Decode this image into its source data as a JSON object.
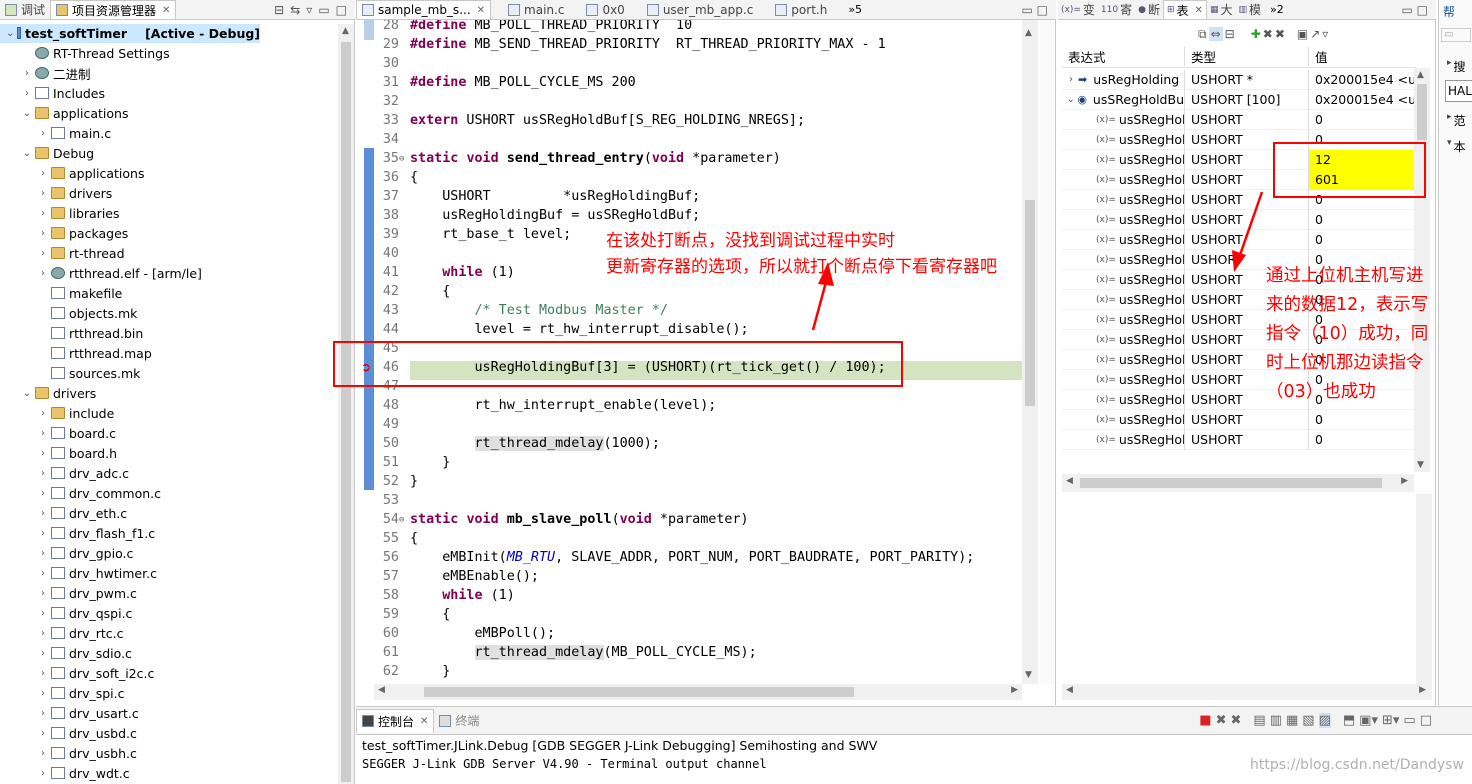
{
  "left_panel": {
    "tabs": [
      {
        "label": "调试",
        "icon": "bug-icon"
      },
      {
        "label": "项目资源管理器",
        "icon": "folder-icon"
      }
    ]
  },
  "tree": [
    {
      "label": "test_softTimer",
      "suffix": "[Active - Debug]",
      "depth": 0,
      "expanded": true,
      "icon": "project-icon"
    },
    {
      "label": "RT-Thread Settings",
      "depth": 1,
      "icon": "settings-icon"
    },
    {
      "label": "二进制",
      "depth": 1,
      "collapsed": true,
      "icon": "binary-icon"
    },
    {
      "label": "Includes",
      "depth": 1,
      "collapsed": true,
      "icon": "includes-icon"
    },
    {
      "label": "applications",
      "depth": 1,
      "expanded": true,
      "icon": "folder-icon"
    },
    {
      "label": "main.c",
      "depth": 2,
      "collapsed": true,
      "icon": "c-file-icon"
    },
    {
      "label": "Debug",
      "depth": 1,
      "expanded": true,
      "icon": "folder-icon"
    },
    {
      "label": "applications",
      "depth": 2,
      "collapsed": true,
      "icon": "folder-icon"
    },
    {
      "label": "drivers",
      "depth": 2,
      "collapsed": true,
      "icon": "folder-icon"
    },
    {
      "label": "libraries",
      "depth": 2,
      "collapsed": true,
      "icon": "folder-icon"
    },
    {
      "label": "packages",
      "depth": 2,
      "collapsed": true,
      "icon": "folder-icon"
    },
    {
      "label": "rt-thread",
      "depth": 2,
      "collapsed": true,
      "icon": "folder-icon"
    },
    {
      "label": "rtthread.elf - [arm/le]",
      "depth": 2,
      "collapsed": true,
      "icon": "elf-icon"
    },
    {
      "label": "makefile",
      "depth": 2,
      "icon": "file-icon"
    },
    {
      "label": "objects.mk",
      "depth": 2,
      "icon": "file-icon"
    },
    {
      "label": "rtthread.bin",
      "depth": 2,
      "icon": "file-icon"
    },
    {
      "label": "rtthread.map",
      "depth": 2,
      "icon": "file-icon"
    },
    {
      "label": "sources.mk",
      "depth": 2,
      "icon": "file-icon"
    },
    {
      "label": "drivers",
      "depth": 1,
      "expanded": true,
      "icon": "folder-icon"
    },
    {
      "label": "include",
      "depth": 2,
      "collapsed": true,
      "icon": "folder-icon"
    },
    {
      "label": "board.c",
      "depth": 2,
      "collapsed": true,
      "icon": "c-file-icon"
    },
    {
      "label": "board.h",
      "depth": 2,
      "collapsed": true,
      "icon": "h-file-icon"
    },
    {
      "label": "drv_adc.c",
      "depth": 2,
      "collapsed": true,
      "icon": "c-file-icon"
    },
    {
      "label": "drv_common.c",
      "depth": 2,
      "collapsed": true,
      "icon": "c-file-icon"
    },
    {
      "label": "drv_eth.c",
      "depth": 2,
      "collapsed": true,
      "icon": "c-file-icon"
    },
    {
      "label": "drv_flash_f1.c",
      "depth": 2,
      "collapsed": true,
      "icon": "c-file-icon"
    },
    {
      "label": "drv_gpio.c",
      "depth": 2,
      "collapsed": true,
      "icon": "c-file-icon"
    },
    {
      "label": "drv_hwtimer.c",
      "depth": 2,
      "collapsed": true,
      "icon": "c-file-icon"
    },
    {
      "label": "drv_pwm.c",
      "depth": 2,
      "collapsed": true,
      "icon": "c-file-icon"
    },
    {
      "label": "drv_qspi.c",
      "depth": 2,
      "collapsed": true,
      "icon": "c-file-icon"
    },
    {
      "label": "drv_rtc.c",
      "depth": 2,
      "collapsed": true,
      "icon": "c-file-icon"
    },
    {
      "label": "drv_sdio.c",
      "depth": 2,
      "collapsed": true,
      "icon": "c-file-icon"
    },
    {
      "label": "drv_soft_i2c.c",
      "depth": 2,
      "collapsed": true,
      "icon": "c-file-icon"
    },
    {
      "label": "drv_spi.c",
      "depth": 2,
      "collapsed": true,
      "icon": "c-file-icon"
    },
    {
      "label": "drv_usart.c",
      "depth": 2,
      "collapsed": true,
      "icon": "c-file-icon"
    },
    {
      "label": "drv_usbd.c",
      "depth": 2,
      "collapsed": true,
      "icon": "c-file-icon"
    },
    {
      "label": "drv_usbh.c",
      "depth": 2,
      "collapsed": true,
      "icon": "c-file-icon"
    },
    {
      "label": "drv_wdt.c",
      "depth": 2,
      "collapsed": true,
      "icon": "c-file-icon"
    }
  ],
  "editor": {
    "tabs": [
      {
        "label": "sample_mb_s...",
        "active": true
      },
      {
        "label": "main.c"
      },
      {
        "label": "0x0"
      },
      {
        "label": "user_mb_app.c"
      },
      {
        "label": "port.h"
      }
    ],
    "overflow": "»5",
    "lines": [
      {
        "n": "28",
        "html": "<span class='kw'>#define</span> MB_POLL_THREAD_PRIORITY  10"
      },
      {
        "n": "29",
        "html": "<span class='kw'>#define</span> MB_SEND_THREAD_PRIORITY  RT_THREAD_PRIORITY_MAX - 1"
      },
      {
        "n": "30",
        "html": ""
      },
      {
        "n": "31",
        "html": "<span class='kw'>#define</span> MB_POLL_CYCLE_MS 200"
      },
      {
        "n": "32",
        "html": ""
      },
      {
        "n": "33",
        "html": "<span class='kw'>extern</span> USHORT usSRegHoldBuf[S_REG_HOLDING_NREGS];"
      },
      {
        "n": "34",
        "html": ""
      },
      {
        "n": "35",
        "html": "<span class='kw'>static</span> <span class='kw'>void</span> <b>send_thread_entry</b>(<span class='kw'>void</span> *parameter)"
      },
      {
        "n": "36",
        "html": "{"
      },
      {
        "n": "37",
        "html": "    USHORT         *usRegHoldingBuf;"
      },
      {
        "n": "38",
        "html": "    usRegHoldingBuf = usSRegHoldBuf;"
      },
      {
        "n": "39",
        "html": "    rt_base_t level;"
      },
      {
        "n": "40",
        "html": ""
      },
      {
        "n": "41",
        "html": "    <span class='kw'>while</span> (1)"
      },
      {
        "n": "42",
        "html": "    {"
      },
      {
        "n": "43",
        "html": "        <span class='cm'>/* Test Modbus Master */</span>"
      },
      {
        "n": "44",
        "html": "        level = rt_hw_interrupt_disable();"
      },
      {
        "n": "45",
        "html": ""
      },
      {
        "n": "46",
        "html": "        usRegHoldingBuf[3] = (USHORT)(rt_tick_get() / 100);"
      },
      {
        "n": "47",
        "html": ""
      },
      {
        "n": "48",
        "html": "        rt_hw_interrupt_enable(level);"
      },
      {
        "n": "49",
        "html": ""
      },
      {
        "n": "50",
        "html": "        <span class='hl'>rt_thread_mdelay</span>(1000);"
      },
      {
        "n": "51",
        "html": "    }"
      },
      {
        "n": "52",
        "html": "}"
      },
      {
        "n": "53",
        "html": ""
      },
      {
        "n": "54",
        "html": "<span class='kw'>static</span> <span class='kw'>void</span> <b>mb_slave_poll</b>(<span class='kw'>void</span> *parameter)"
      },
      {
        "n": "55",
        "html": "{"
      },
      {
        "n": "56",
        "html": "    eMBInit(<span class='it'>MB_RTU</span>, SLAVE_ADDR, PORT_NUM, PORT_BAUDRATE, PORT_PARITY);"
      },
      {
        "n": "57",
        "html": "    eMBEnable();"
      },
      {
        "n": "58",
        "html": "    <span class='kw'>while</span> (1)"
      },
      {
        "n": "59",
        "html": "    {"
      },
      {
        "n": "60",
        "html": "        eMBPoll();"
      },
      {
        "n": "61",
        "html": "        <span class='hl'>rt_thread_mdelay</span>(MB_POLL_CYCLE_MS);"
      },
      {
        "n": "62",
        "html": "    }"
      }
    ]
  },
  "annotation_left": {
    "line1": "在该处打断点，没找到调试过程中实时",
    "line2": "更新寄存器的选项，所以就打个断点停下看寄存器吧"
  },
  "annotation_right": {
    "line1": "通过上位机主机写进",
    "line2": "来的数据12，表示写",
    "line3": "指令（10）成功，同",
    "line4": "时上位机那边读指令",
    "line5": "（03）也成功"
  },
  "vars": {
    "tabs": [
      {
        "label": "变"
      },
      {
        "label": "寄"
      },
      {
        "label": "断"
      },
      {
        "label": "表",
        "active": true
      },
      {
        "label": "大"
      },
      {
        "label": "模"
      }
    ],
    "overflow": "»2",
    "headers": {
      "expr": "表达式",
      "type": "类型",
      "value": "值"
    },
    "rows": [
      {
        "expr": "usRegHolding",
        "type": "USHORT *",
        "value": "0x200015e4 <usS",
        "kind": "pointer"
      },
      {
        "expr": "usSRegHoldBu",
        "type": "USHORT [100]",
        "value": "0x200015e4 <usS",
        "kind": "array"
      },
      {
        "expr": "usSRegHolc",
        "type": "USHORT",
        "value": "0"
      },
      {
        "expr": "usSRegHolc",
        "type": "USHORT",
        "value": "0"
      },
      {
        "expr": "usSRegHolc",
        "type": "USHORT",
        "value": "12",
        "highlight": true
      },
      {
        "expr": "usSRegHolc",
        "type": "USHORT",
        "value": "601",
        "highlight": true
      },
      {
        "expr": "usSRegHolc",
        "type": "USHORT",
        "value": "0"
      },
      {
        "expr": "usSRegHolc",
        "type": "USHORT",
        "value": "0"
      },
      {
        "expr": "usSRegHolc",
        "type": "USHORT",
        "value": "0"
      },
      {
        "expr": "usSRegHolc",
        "type": "USHORT",
        "value": "0"
      },
      {
        "expr": "usSRegHolc",
        "type": "USHORT",
        "value": "0"
      },
      {
        "expr": "usSRegHolc",
        "type": "USHORT",
        "value": "0"
      },
      {
        "expr": "usSRegHolc",
        "type": "USHORT",
        "value": "0"
      },
      {
        "expr": "usSRegHolc",
        "type": "USHORT",
        "value": "0"
      },
      {
        "expr": "usSRegHolc",
        "type": "USHORT",
        "value": "0"
      },
      {
        "expr": "usSRegHolc",
        "type": "USHORT",
        "value": "0"
      },
      {
        "expr": "usSRegHolc",
        "type": "USHORT",
        "value": "0"
      },
      {
        "expr": "usSRegHolc",
        "type": "USHORT",
        "value": "0"
      },
      {
        "expr": "usSRegHolc",
        "type": "USHORT",
        "value": "0"
      }
    ]
  },
  "right_strip": {
    "labels": [
      "搜",
      "HAL",
      "范",
      "本"
    ]
  },
  "console": {
    "tabs": [
      {
        "label": "控制台",
        "active": true
      },
      {
        "label": "终端"
      }
    ],
    "title": "test_softTimer.JLink.Debug [GDB SEGGER J-Link Debugging] Semihosting and SWV",
    "line": "SEGGER J-Link GDB Server V4.90 - Terminal output channel"
  },
  "watermark": "https://blog.csdn.net/Dandysw"
}
